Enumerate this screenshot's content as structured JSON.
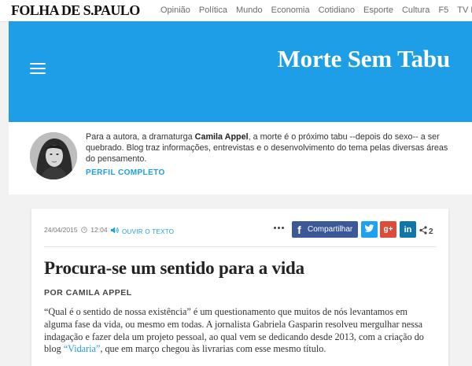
{
  "header": {
    "logo": "FOLHA DE S.PAULO",
    "nav": [
      "Opinião",
      "Política",
      "Mundo",
      "Economia",
      "Cotidiano",
      "Esporte",
      "Cultura",
      "F5",
      "TV Fol"
    ]
  },
  "banner": {
    "menu_icon": "hamburger-menu-icon",
    "title": "Morte Sem Tabu",
    "color": "#1e9ee6"
  },
  "author": {
    "desc_before": "Para a autora, a dramaturga ",
    "name": "Camila Appel",
    "desc_after": ", a morte é o próximo tabu --depois do sexo-- a ser quebrado. Blog traz informações, entrevistas e o desenvolvimento do tema pelas diversas áreas do pensamento.",
    "profile_link": "PERFIL COMPLETO"
  },
  "article": {
    "date": "24/04/2015",
    "time": "12:04",
    "listen_label": "OUVIR O TEXTO",
    "share_label": "Compartilhar",
    "share_count": "2",
    "title": "Procura-se um sentido para a vida",
    "byline": "POR CAMILA APPEL",
    "body_before": "“Qual é o sentido de nossa existência” é um questionamento que muitos de nós levantamos em alguma fase da vida, ou mesmo em todas. A jornalista Gabriela Gasparin resolveu mergulhar nessa indagação e fazer dela um projeto pessoal, ao qual vem se dedicando desde 2013, com a criação do blog ",
    "body_link": "“Vidaria”",
    "body_after": ", que em março chegou às livrarias com esse mesmo título."
  },
  "colors": {
    "facebook": "#3b5998",
    "twitter": "#1da1f2",
    "googleplus": "#dd4b39",
    "linkedin": "#0e76a8"
  }
}
